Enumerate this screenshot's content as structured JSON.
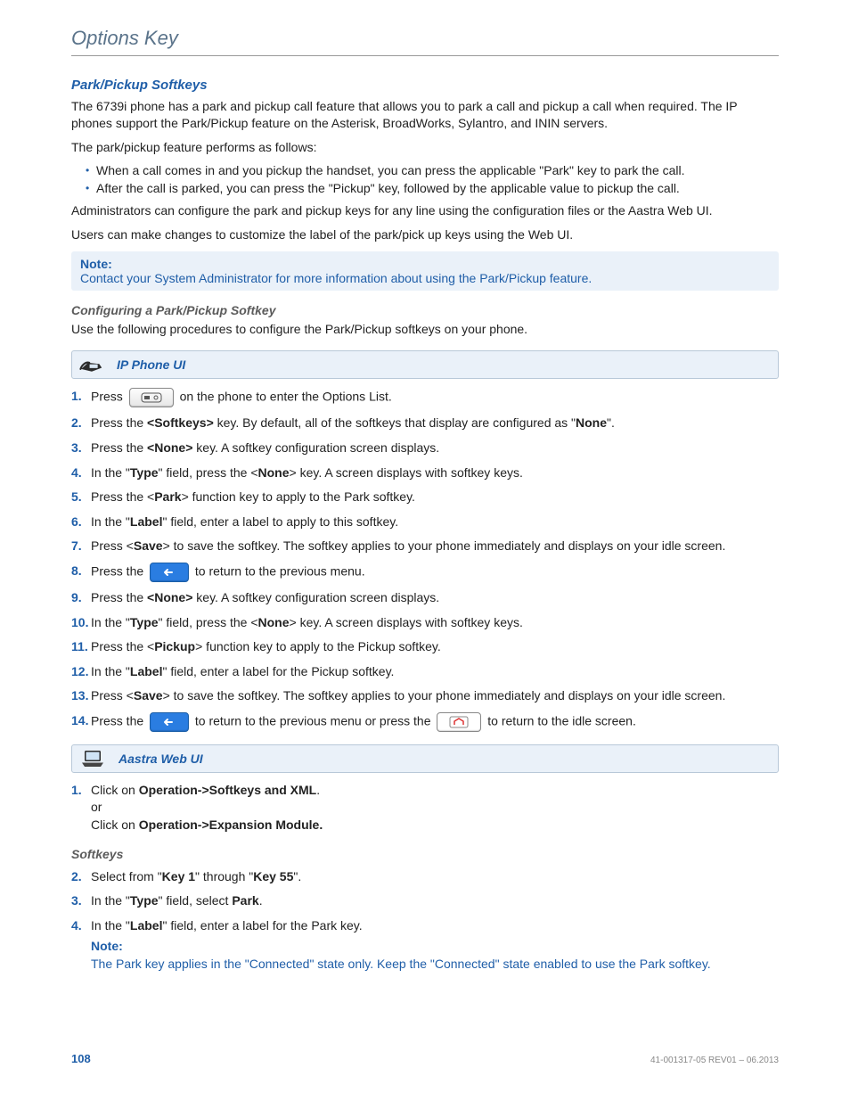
{
  "header": {
    "title": "Options Key"
  },
  "section": {
    "h2": "Park/Pickup Softkeys",
    "p1": "The 6739i phone has a park and pickup call feature that allows you to park a call and pickup a call when required. The IP phones support the Park/Pickup feature on the Asterisk, BroadWorks, Sylantro, and ININ servers.",
    "p2": "The park/pickup feature performs as follows:",
    "bullets": [
      "When a call comes in and you pickup the handset, you can press the applicable \"Park\" key to park the call.",
      "After the call is parked, you can press the \"Pickup\" key, followed by the applicable value to pickup the call."
    ],
    "p3": "Administrators can configure the park and pickup keys for any line using the configuration files or the Aastra Web UI.",
    "p4": "Users can make changes to customize the label of the park/pick up keys using the Web UI."
  },
  "note": {
    "label": "Note:",
    "body": "Contact your System Administrator for more information about using the Park/Pickup feature."
  },
  "configure": {
    "h3": "Configuring a Park/Pickup Softkey",
    "p": "Use the following procedures to configure the Park/Pickup softkeys on your phone."
  },
  "bars": {
    "ipphone": "IP Phone UI",
    "webui": "Aastra Web UI"
  },
  "steps_ip": {
    "s1a": "Press ",
    "s1b": " on the phone to enter the Options List.",
    "s2a": "Press the ",
    "s2b": "<Softkeys>",
    "s2c": " key. By default, all of the softkeys that display are configured as \"",
    "s2d": "None",
    "s2e": "\".",
    "s3a": "Press the ",
    "s3b": "<None>",
    "s3c": " key. A softkey configuration screen displays.",
    "s4a": "In the \"",
    "s4b": "Type",
    "s4c": "\" field, press the <",
    "s4d": "None",
    "s4e": "> key. A screen displays with softkey keys.",
    "s5a": "Press the <",
    "s5b": "Park",
    "s5c": "> function key to apply to the Park softkey.",
    "s6a": "In the \"",
    "s6b": "Label",
    "s6c": "\" field, enter a label to apply to this softkey.",
    "s7a": "Press <",
    "s7b": "Save",
    "s7c": "> to save the softkey. The softkey applies to your phone immediately and displays on your idle screen.",
    "s8a": "Press the ",
    "s8b": " to return to the previous menu.",
    "s9a": "Press the ",
    "s9b": "<None>",
    "s9c": " key. A softkey configuration screen displays.",
    "s10a": "In the \"",
    "s10b": "Type",
    "s10c": "\" field, press the <",
    "s10d": "None",
    "s10e": "> key. A screen displays with softkey keys.",
    "s11a": "Press the <",
    "s11b": "Pickup",
    "s11c": "> function key to apply to the Pickup softkey.",
    "s12a": "In the \"",
    "s12b": "Label",
    "s12c": "\" field, enter a label for the Pickup softkey.",
    "s13a": "Press <",
    "s13b": "Save",
    "s13c": "> to save the softkey. The softkey applies to your phone immediately and displays on your idle screen.",
    "s14a": "Press the ",
    "s14b": " to return to the previous menu or press the ",
    "s14c": " to return to the idle screen."
  },
  "steps_web": {
    "s1a": "Click on ",
    "s1b": "Operation->Softkeys and XML",
    "s1c": ".",
    "s1or": "or",
    "s1d": "Click on ",
    "s1e": "Operation->Expansion Module.",
    "h3": "Softkeys",
    "s2a": "Select from \"",
    "s2b": "Key 1",
    "s2c": "\" through \"",
    "s2d": "Key 55",
    "s2e": "\".",
    "s3a": "In the \"",
    "s3b": "Type",
    "s3c": "\" field, select ",
    "s3d": "Park",
    "s3e": ".",
    "s4a": "In the \"",
    "s4b": "Label",
    "s4c": "\" field, enter a label for the Park key.",
    "s4note_label": "Note:",
    "s4note_body": "The Park key applies in the \"Connected\" state only. Keep the \"Connected\" state enabled to use the Park softkey."
  },
  "footer": {
    "page": "108",
    "doc": "41-001317-05 REV01 – 06.2013"
  }
}
